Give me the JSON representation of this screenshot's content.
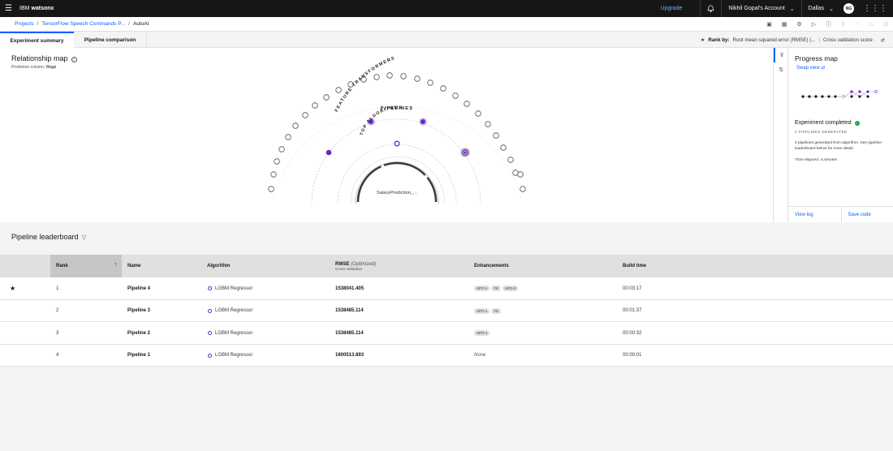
{
  "topbar": {
    "brand_a": "IBM",
    "brand_b": "watsonx",
    "upgrade": "Upgrade",
    "account": "Nikhil Gopal's Account",
    "region": "Dallas",
    "avatar": "NG"
  },
  "breadcrumb": {
    "projects": "Projects",
    "project": "TensorFlow Speech Commands P...",
    "current": "AutoAI"
  },
  "tabs": {
    "summary": "Experiment summary",
    "comparison": "Pipeline comparison"
  },
  "rank_by": {
    "label": "Rank by:",
    "metric": "Root mean squared error (RMSE) (...",
    "score": "Cross validation score"
  },
  "relationship": {
    "title": "Relationship map",
    "pred_label": "Prediction column:",
    "pred_value": "Wage",
    "ring_features": "FEATURE TRANSFORMERS",
    "ring_pipelines": "PIPELINES",
    "ring_algorithms": "TOP ALGORITHMS",
    "center": "SalaryPrediction_..."
  },
  "progress": {
    "title": "Progress map",
    "swap": "Swap view",
    "status": "Experiment completed",
    "generated": "4 PIPELINES GENERATED",
    "desc": "4 pipelines generated from algorithm. See pipeline leaderboard below for more detail.",
    "elapsed": "Time elapsed: 4 minutes",
    "view_log": "View log",
    "save_code": "Save code"
  },
  "leaderboard": {
    "title": "Pipeline leaderboard",
    "headers": {
      "rank": "Rank",
      "name": "Name",
      "algorithm": "Algorithm",
      "rmse": "RMSE",
      "rmse_opt": "(Optimized)",
      "rmse_sub": "Cross Validation",
      "enh": "Enhancements",
      "build": "Build time"
    },
    "rows": [
      {
        "rank": "1",
        "name": "Pipeline 4",
        "algorithm": "LGBM Regressor",
        "rmse": "1538041.405",
        "enh": [
          "HPO-1",
          "FE",
          "HPO-2"
        ],
        "time": "00:03:17"
      },
      {
        "rank": "2",
        "name": "Pipeline 3",
        "algorithm": "LGBM Regressor",
        "rmse": "1538485.114",
        "enh": [
          "HPO-1",
          "FE"
        ],
        "time": "00:01:37"
      },
      {
        "rank": "3",
        "name": "Pipeline 2",
        "algorithm": "LGBM Regressor",
        "rmse": "1538485.114",
        "enh": [
          "HPO-1"
        ],
        "time": "00:00:32"
      },
      {
        "rank": "4",
        "name": "Pipeline 1",
        "algorithm": "LGBM Regressor",
        "rmse": "1600513.893",
        "enh": [],
        "enh_none": "None",
        "time": "00:00:01"
      }
    ]
  },
  "colors": {
    "accent": "#0f62fe",
    "purple": "#6929c4",
    "success": "#24a148"
  }
}
